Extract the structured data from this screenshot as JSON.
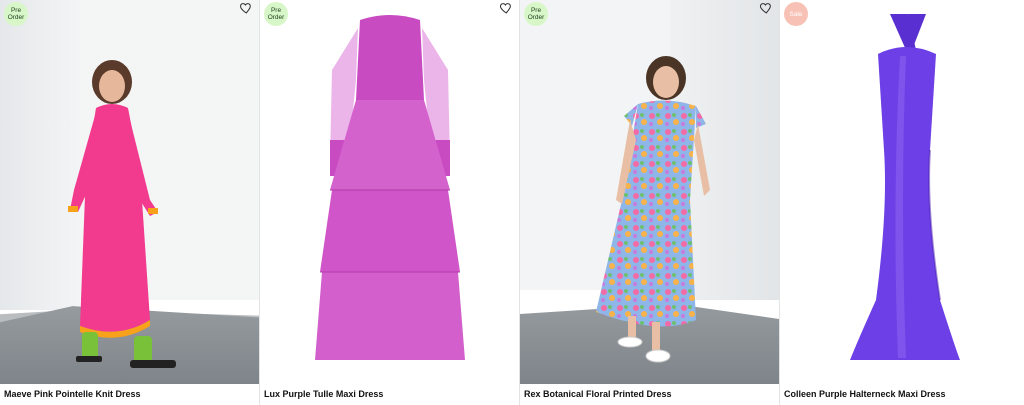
{
  "products": [
    {
      "name": "Maeve Pink Pointelle Knit Dress",
      "badge_line1": "Pre",
      "badge_line2": "Order"
    },
    {
      "name": "Lux Purple Tulle Maxi Dress",
      "badge_line1": "Pre",
      "badge_line2": "Order"
    },
    {
      "name": "Rex Botanical Floral Printed Dress",
      "badge_line1": "Pre",
      "badge_line2": "Order"
    },
    {
      "name": "Colleen Purple Halterneck Maxi Dress",
      "badge_line1": "Sale",
      "badge_line2": ""
    }
  ],
  "colors": {
    "preorder_badge": "#d8f7c8",
    "sale_badge": "#f7c2b5",
    "pink_dress": "#f23b8f",
    "tulle_dress": "#cf4ec7",
    "halter_dress": "#6d3fe6"
  },
  "icons": {
    "wishlist": "heart-icon"
  }
}
